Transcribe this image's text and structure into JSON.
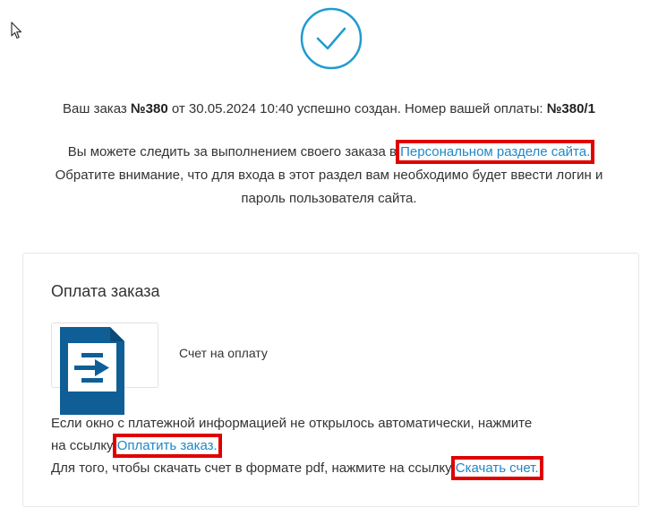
{
  "header": {
    "order_line_prefix": "Ваш заказ ",
    "order_number": "№380",
    "order_line_middle": " от 30.05.2024 10:40 успешно создан. Номер вашей оплаты: ",
    "payment_number": "№380/1",
    "track_prefix": "Вы можете следить за выполнением своего заказа в",
    "personal_section_link": "Персональном разделе сайта",
    "track_suffix": ".",
    "notice_line_1": "Обратите внимание, что для входа в этот раздел вам необходимо будет ввести логин и",
    "notice_line_2": "пароль пользователя сайта."
  },
  "payment": {
    "title": "Оплата заказа",
    "method_label": "Счет на оплату",
    "info_line_1": "Если окно с платежной информацией не открылось автоматически, нажмите",
    "info_line_2_prefix": "на ссылку ",
    "pay_link": "Оплатить заказ.",
    "info_line_3_prefix": "Для того, чтобы скачать счет в формате pdf, нажмите на ссылку ",
    "download_link": "Скачать счет."
  },
  "colors": {
    "accent": "#1e88c8",
    "highlight": "#e00000",
    "doc_icon": "#0f5f96"
  },
  "icons": {
    "success": "check-circle-icon",
    "document": "document-arrow-icon",
    "cursor": "mouse-pointer-icon"
  }
}
